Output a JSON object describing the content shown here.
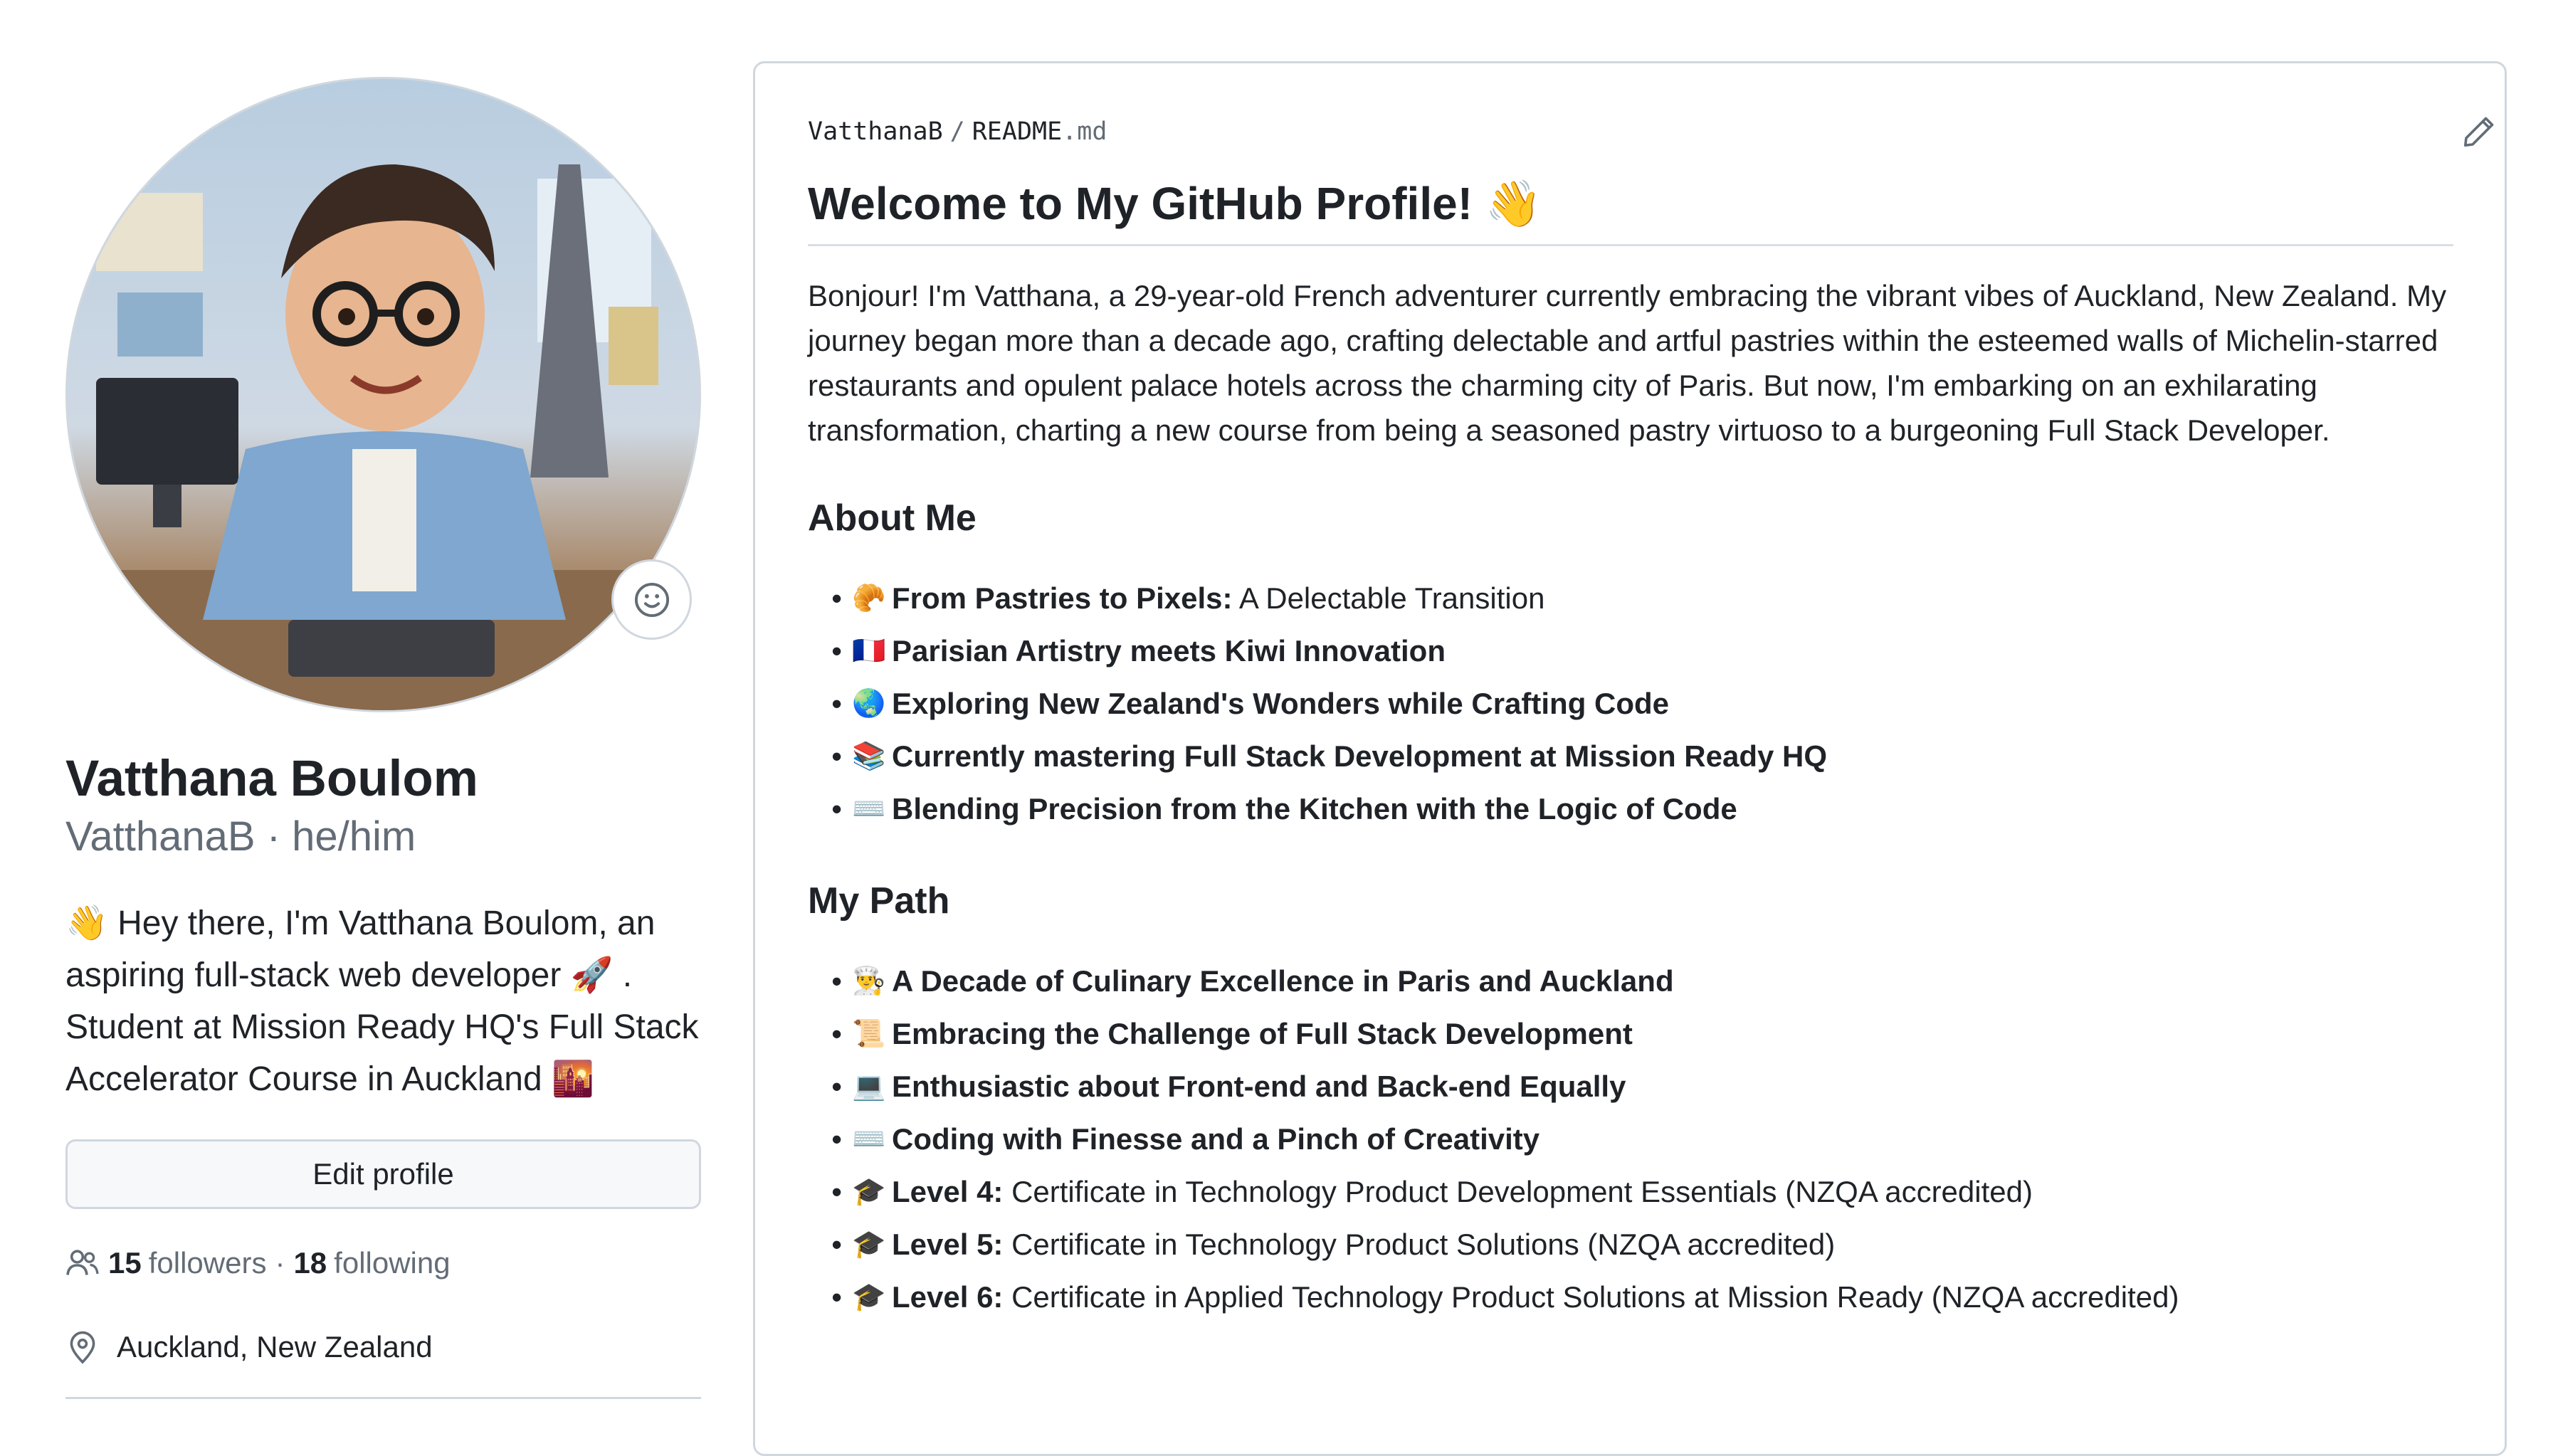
{
  "profile": {
    "full_name": "Vatthana Boulom",
    "login_pronouns": "VatthanaB · he/him",
    "bio": "👋 Hey there, I'm Vatthana Boulom, an aspiring full-stack web developer 🚀 . Student at Mission Ready HQ's Full Stack Accelerator Course in Auckland 🌇",
    "edit_button": "Edit profile",
    "followers_count": "15",
    "followers_label": "followers",
    "separator": "·",
    "following_count": "18",
    "following_label": "following",
    "location": "Auckland, New Zealand",
    "icons": {
      "status": "smiley-icon",
      "people": "people-icon",
      "location": "location-pin-icon"
    }
  },
  "readme": {
    "owner": "VatthanaB",
    "path_sep": "/",
    "file_name": "README",
    "file_ext": ".md",
    "title": "Welcome to My GitHub Profile! 👋",
    "intro": "Bonjour! I'm Vatthana, a 29-year-old French adventurer currently embracing the vibrant vibes of Auckland, New Zealand. My journey began more than a decade ago, crafting delectable and artful pastries within the esteemed walls of Michelin-starred restaurants and opulent palace hotels across the charming city of Paris. But now, I'm embarking on an exhilarating transformation, charting a new course from being a seasoned pastry virtuoso to a burgeoning Full Stack Developer.",
    "about_heading": "About Me",
    "about_items": [
      {
        "emoji": "🥐",
        "bold": "From Pastries to Pixels:",
        "rest": " A Delectable Transition"
      },
      {
        "emoji": "🇫🇷",
        "bold": "Parisian Artistry meets Kiwi Innovation",
        "rest": ""
      },
      {
        "emoji": "🌏",
        "bold": "Exploring New Zealand's Wonders while Crafting Code",
        "rest": ""
      },
      {
        "emoji": "📚",
        "bold": "Currently mastering Full Stack Development at Mission Ready HQ",
        "rest": ""
      },
      {
        "emoji": "⌨️",
        "bold": "Blending Precision from the Kitchen with the Logic of Code",
        "rest": ""
      }
    ],
    "path_heading": "My Path",
    "path_items": [
      {
        "emoji": "👨‍🍳",
        "bold": "A Decade of Culinary Excellence in Paris and Auckland",
        "rest": ""
      },
      {
        "emoji": "📜",
        "bold": "Embracing the Challenge of Full Stack Development",
        "rest": ""
      },
      {
        "emoji": "💻",
        "bold": "Enthusiastic about Front-end and Back-end Equally",
        "rest": ""
      },
      {
        "emoji": "⌨️",
        "bold": "Coding with Finesse and a Pinch of Creativity",
        "rest": ""
      },
      {
        "emoji": "🎓",
        "bold": "Level 4:",
        "rest": " Certificate in Technology Product Development Essentials (NZQA accredited)"
      },
      {
        "emoji": "🎓",
        "bold": "Level 5:",
        "rest": " Certificate in Technology Product Solutions (NZQA accredited)"
      },
      {
        "emoji": "🎓",
        "bold": "Level 6:",
        "rest": " Certificate in Applied Technology Product Solutions at Mission Ready (NZQA accredited)"
      }
    ],
    "icons": {
      "edit": "pencil-icon"
    }
  }
}
